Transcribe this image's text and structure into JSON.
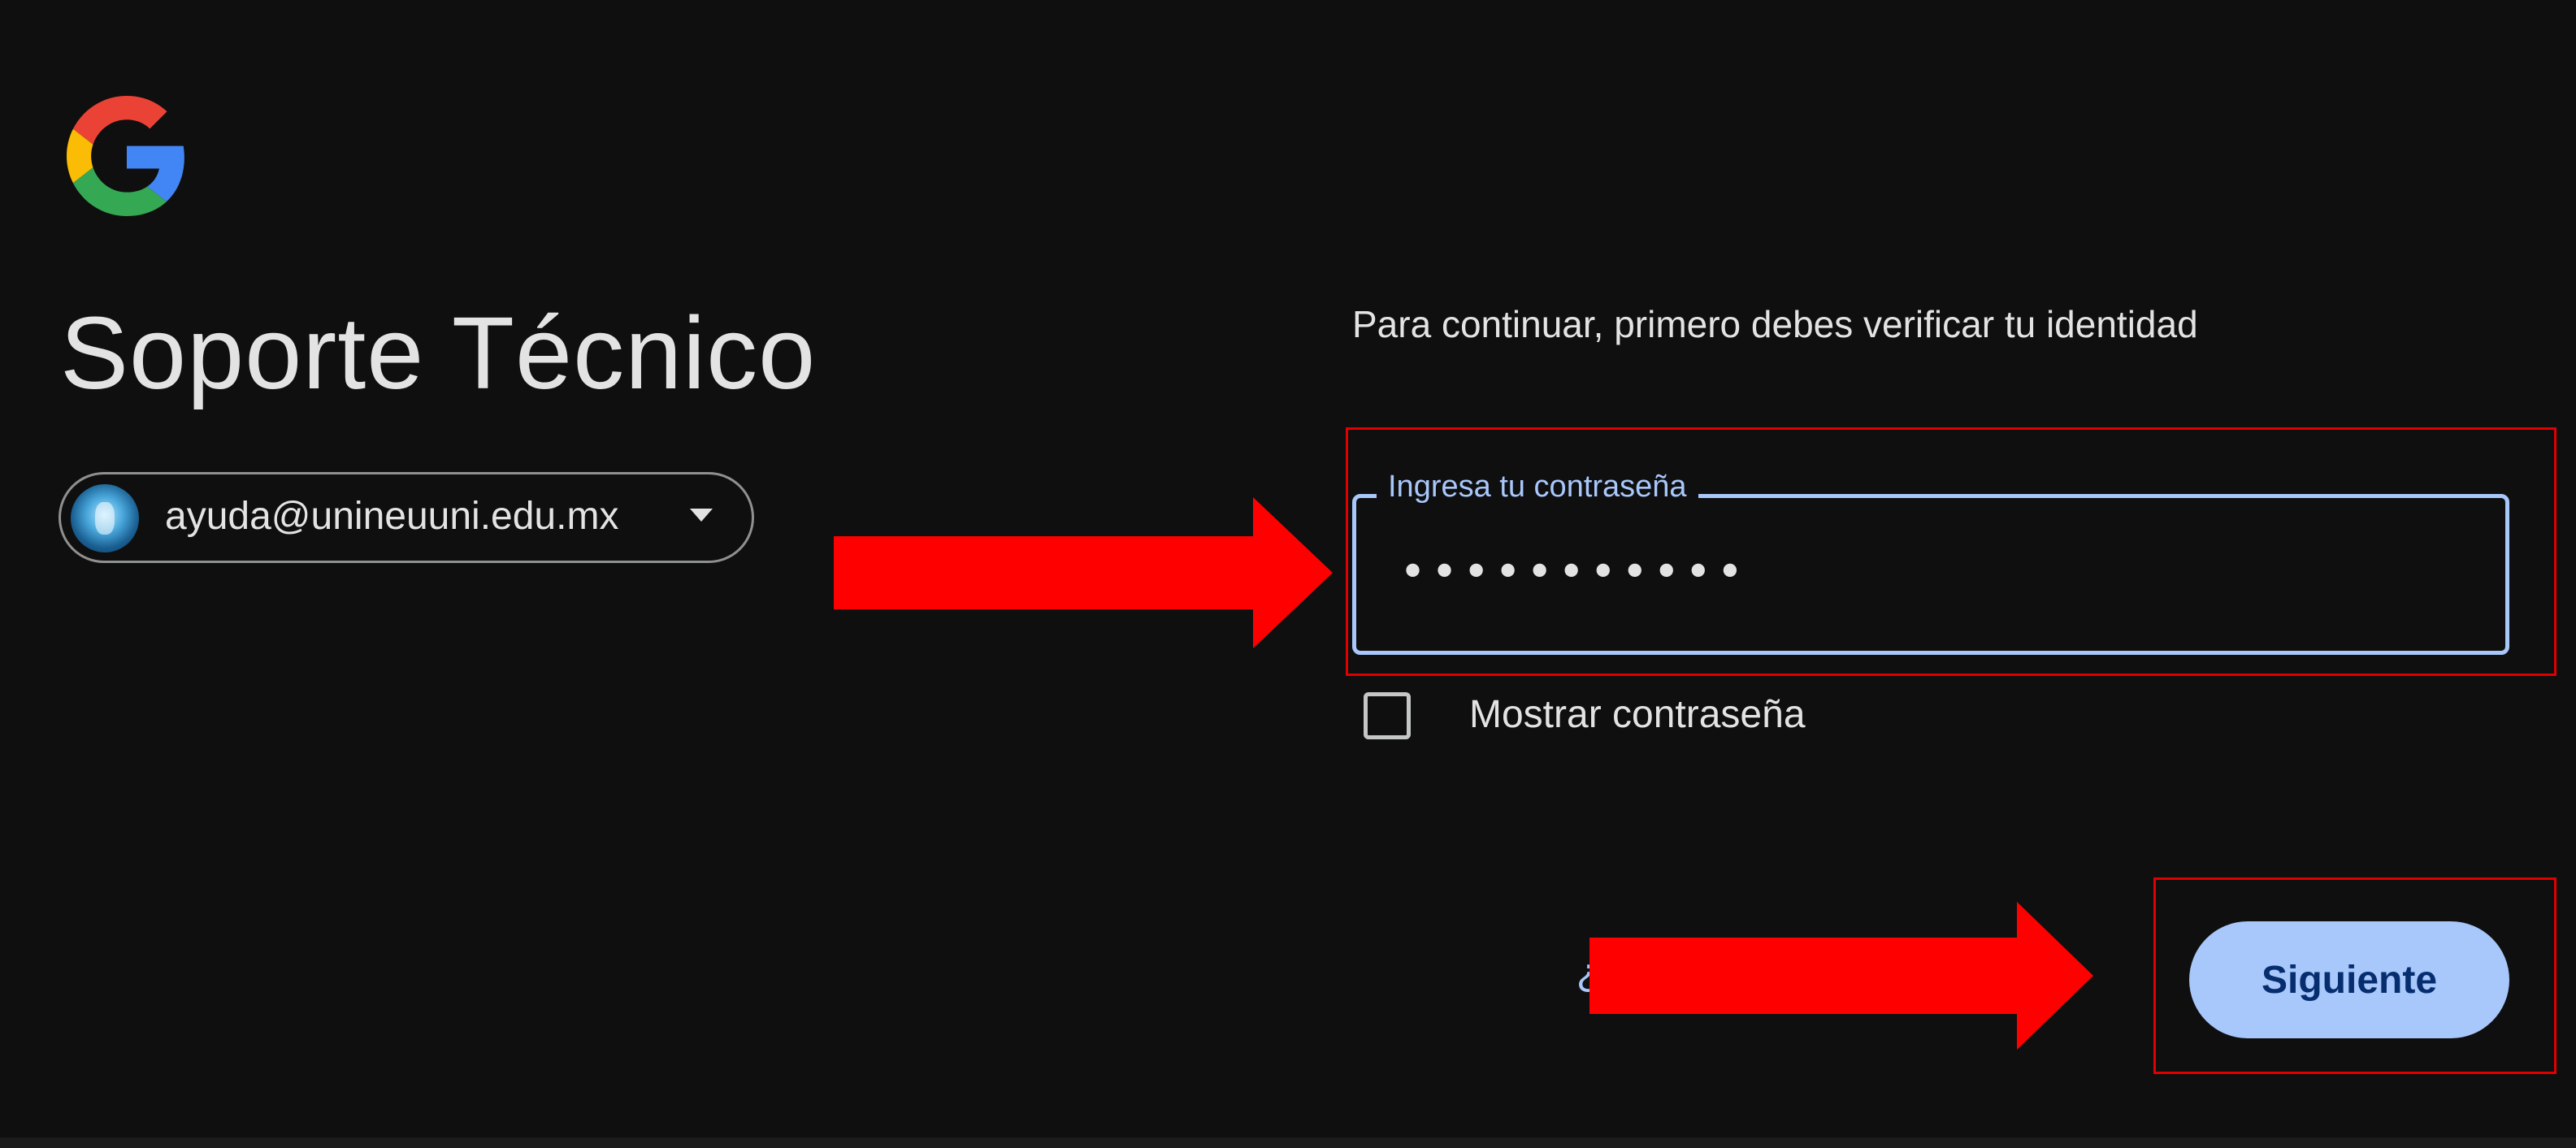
{
  "brand": {
    "logo_icon": "google-g-logo-icon"
  },
  "page_title": "Soporte Técnico",
  "account": {
    "email": "ayuda@unineuuni.edu.mx",
    "avatar_icon": "account-avatar",
    "dropdown_icon": "chevron-down-icon"
  },
  "instruction": "Para continuar, primero debes verificar tu identidad",
  "password": {
    "label": "Ingresa tu contraseña",
    "masked_value": "•••••••••••"
  },
  "show_password": {
    "label": "Mostrar contraseña",
    "checked": false
  },
  "forgot_link_fragment": "¿",
  "next_button": {
    "label": "Siguiente"
  },
  "annotations": {
    "arrow_color": "#ff0000",
    "highlight_color": "#e00000"
  },
  "colors": {
    "background": "#0f0f0f",
    "text_primary": "#e3e3e3",
    "accent": "#a8c7fa",
    "button_text": "#062e6f"
  }
}
